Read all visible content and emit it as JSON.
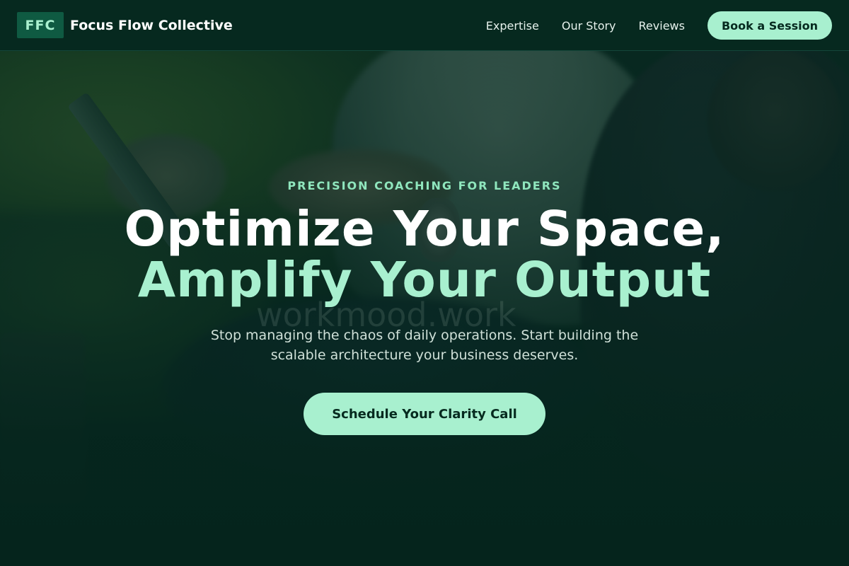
{
  "header": {
    "logo_badge": "FFC",
    "brand_name": "Focus Flow Collective",
    "nav": [
      {
        "label": "Expertise"
      },
      {
        "label": "Our Story"
      },
      {
        "label": "Reviews"
      }
    ],
    "cta_label": "Book a Session"
  },
  "hero": {
    "eyebrow": "PRECISION COACHING FOR LEADERS",
    "headline_line1": "Optimize Your Space,",
    "headline_line2": "Amplify Your Output",
    "subtext": "Stop managing the chaos of daily operations. Start building the scalable architecture your business deserves.",
    "cta_label": "Schedule Your Clarity Call",
    "image_watermark": "workmood.work"
  },
  "colors": {
    "header_bg": "#06291f",
    "accent_mint": "#a8f0cf",
    "eyebrow_green": "#8fe6bd",
    "logo_badge_bg": "#0f5a42",
    "overlay_dark_green": "#05251d"
  }
}
